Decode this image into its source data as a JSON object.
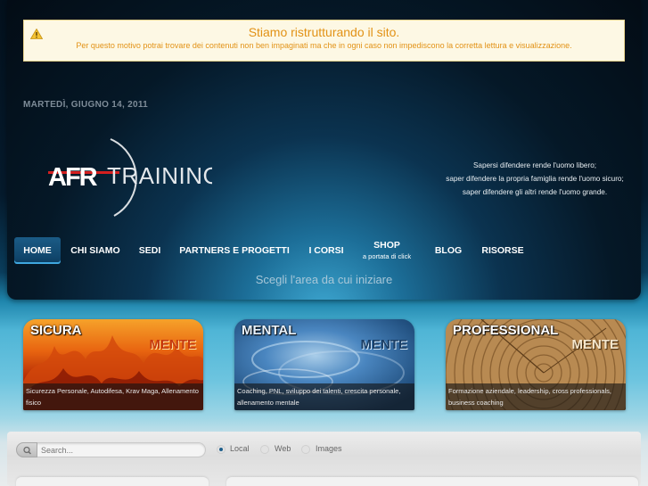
{
  "notice": {
    "title": "Stiamo ristrutturando il sito.",
    "text": "Per questo motivo potrai trovare dei contenuti non ben impaginati ma che in ogni caso non impediscono la corretta lettura e visualizzazione."
  },
  "date": "MARTEDÌ, GIUGNO 14, 2011",
  "logo": {
    "mark": "AFR",
    "word": "TRAINING"
  },
  "motto": [
    "Sapersi difendere rende l'uomo libero;",
    "saper difendere la propria famiglia rende l'uomo sicuro;",
    "saper difendere gli altri rende l'uomo grande."
  ],
  "nav": {
    "items": [
      {
        "label": "HOME",
        "active": true
      },
      {
        "label": "CHI SIAMO"
      },
      {
        "label": "SEDI"
      },
      {
        "label": "PARTNERS E PROGETTI"
      },
      {
        "label": "I CORSI"
      },
      {
        "label": "SHOP",
        "sub": "a portata di click"
      },
      {
        "label": "BLOG"
      },
      {
        "label": "RISORSE"
      }
    ]
  },
  "tagline": "Scegli l'area da cui iniziare",
  "cards": [
    {
      "title": "SICURA",
      "title2": "MENTE",
      "desc": "Sicurezza Personale, Autodifesa, Krav Maga, Allenamento fisico"
    },
    {
      "title": "MENTAL",
      "title2": "MENTE",
      "desc": "Coaching, PNL, sviluppo dei talenti, crescita personale, allenamento mentale"
    },
    {
      "title": "PROFESSIONAL",
      "title2": "MENTE",
      "desc": "Formazione aziendale, leadership, cross professionals, business coaching"
    }
  ],
  "search": {
    "placeholder": "Search...",
    "options": [
      "Local",
      "Web",
      "Images"
    ],
    "selected": "Local"
  },
  "colors": {
    "accent": "#3fa7df",
    "notice_text": "#e29216"
  }
}
